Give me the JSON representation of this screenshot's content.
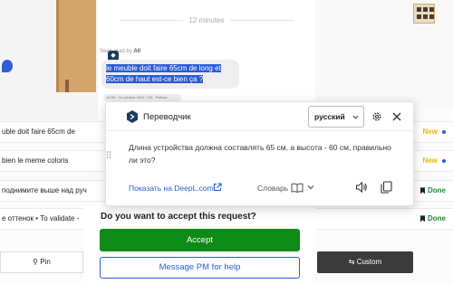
{
  "chat": {
    "time_divider": "12 minutes",
    "read_by_prefix": "Seen read by",
    "read_by_name": "All",
    "message_line1": "le meuble doit faire 65cm de long et",
    "message_line2": "60cm de haut est-ce bien ça ?",
    "message_meta": "14:58 · 04 octobre 2024 7:03 · Refusé"
  },
  "rows": [
    {
      "text": "uble doit faire 65cm de",
      "status": "New",
      "status_type": "new"
    },
    {
      "text": "bien le meme coloris",
      "status": "New",
      "status_type": "new"
    },
    {
      "text": "поднимите выше над руч",
      "status": "Done",
      "status_type": "done"
    },
    {
      "text": "e оттенок • To validate -",
      "status": "Done",
      "status_type": "done"
    }
  ],
  "approval": {
    "question": "Do you want to accept this request?",
    "accept_label": "Accept",
    "pm_label": "Message PM for help"
  },
  "bottom": {
    "pin_label": "Pin",
    "custom_label": "Custom"
  },
  "translator": {
    "title": "Переводчик",
    "language": "русский",
    "translation": "Длина устройства должна составлять 65 см, а высота - 60 см, правильно ли это?",
    "deepl_link": "Показать на DeepL.com",
    "dictionary_label": "Словарь"
  },
  "colors": {
    "accent_blue": "#2a5bd7",
    "accept_green": "#0e8a16",
    "status_new": "#f0b400",
    "status_done": "#1e8a36",
    "deepl_navy": "#1f3a5c"
  }
}
